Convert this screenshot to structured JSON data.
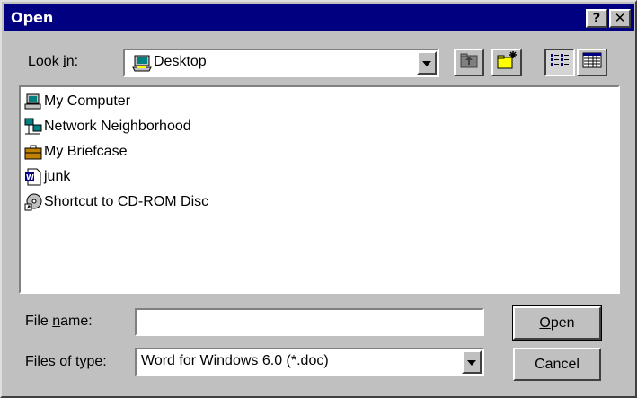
{
  "window": {
    "title": "Open",
    "help_glyph": "?",
    "close_glyph": "✕"
  },
  "look_in": {
    "label_pre": "Look ",
    "label_accel": "i",
    "label_post": "n:",
    "value": "Desktop",
    "icon": "desktop-icon"
  },
  "toolbar": [
    {
      "name": "up-one-level",
      "icon": "folder-up-icon"
    },
    {
      "name": "create-new-folder",
      "icon": "new-folder-icon"
    },
    {
      "name": "list-view",
      "icon": "list-view-icon"
    },
    {
      "name": "details-view",
      "icon": "details-view-icon"
    }
  ],
  "files": [
    {
      "label": "My Computer",
      "icon": "computer-icon"
    },
    {
      "label": "Network Neighborhood",
      "icon": "network-icon"
    },
    {
      "label": "My Briefcase",
      "icon": "briefcase-icon"
    },
    {
      "label": "junk",
      "icon": "word-document-icon"
    },
    {
      "label": "Shortcut to CD-ROM Disc",
      "icon": "cdrom-shortcut-icon"
    }
  ],
  "file_name": {
    "label_pre": "File ",
    "label_accel": "n",
    "label_post": "ame:",
    "value": ""
  },
  "file_type": {
    "label_pre": "Files of ",
    "label_accel": "t",
    "label_post": "ype:",
    "value": "Word for Windows 6.0 (*.doc)"
  },
  "buttons": {
    "open_accel": "O",
    "open_rest": "pen",
    "cancel": "Cancel"
  },
  "colors": {
    "titlebar": "#000080",
    "face": "#c0c0c0",
    "field": "#ffffff"
  }
}
